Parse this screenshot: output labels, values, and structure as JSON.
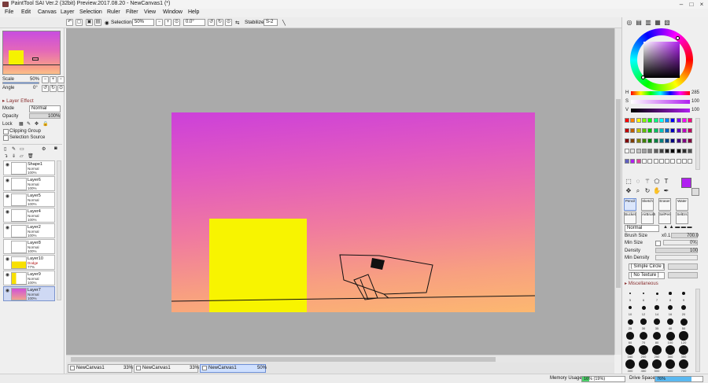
{
  "window": {
    "title": "PaintTool SAI Ver.2 (32bit) Preview.2017.08.20 - NewCanvas1 (*)"
  },
  "menu": [
    "File",
    "Edit",
    "Canvas",
    "Layer",
    "Selection",
    "Ruler",
    "Filter",
    "View",
    "Window",
    "Help"
  ],
  "toolbar": {
    "selection_label": "Selection",
    "zoom": "50%",
    "angle": "0.0°",
    "stabilizer_label": "Stabilizer",
    "stabilizer": "S-2"
  },
  "navigator": {
    "scale_label": "Scale",
    "scale": "50%",
    "angle_label": "Angle",
    "angle": "0°"
  },
  "layer_props": {
    "section": "Layer Effect",
    "mode_label": "Mode",
    "mode": "Normal",
    "opacity_label": "Opacity",
    "opacity": "100%",
    "lock_label": "Lock",
    "clipping": "Clipping Group",
    "selection_source": "Selection Source"
  },
  "layers": [
    {
      "name": "Shape1",
      "mode": "Normal",
      "opacity": "100%"
    },
    {
      "name": "Layer6",
      "mode": "Normal",
      "opacity": "100%"
    },
    {
      "name": "Layer5",
      "mode": "Normal",
      "opacity": "100%"
    },
    {
      "name": "Layer4",
      "mode": "Normal",
      "opacity": "100%"
    },
    {
      "name": "Layer2",
      "mode": "Normal",
      "opacity": "100%"
    },
    {
      "name": "Layer8",
      "mode": "Normal",
      "opacity": "100%"
    },
    {
      "name": "Layer10",
      "mode": "Dodge",
      "opacity": "77%"
    },
    {
      "name": "Layer9",
      "mode": "Normal",
      "opacity": "100%"
    },
    {
      "name": "Layer7",
      "mode": "Normal",
      "opacity": "100%"
    }
  ],
  "tabs": [
    {
      "name": "NewCanvas1",
      "zoom": "33%"
    },
    {
      "name": "NewCanvas1",
      "zoom": "33%"
    },
    {
      "name": "NewCanvas1",
      "zoom": "50%"
    }
  ],
  "status": {
    "memory_label": "Memory Usage",
    "memory": "16% (19%)",
    "drive_label": "Drive Space",
    "drive": "76%",
    "memory_fraction": 0.16,
    "drive_fraction": 0.76
  },
  "color": {
    "h_label": "H",
    "h": "285",
    "s_label": "S",
    "s": "100",
    "v_label": "V",
    "v": "100",
    "current": "#b020f0"
  },
  "tools": {
    "pencil": "Pencil",
    "sketch": "Sketch",
    "eraser": "Eraser",
    "water": "Water",
    "bucket": "Bucket",
    "airbrush": "AirBrush",
    "selpen": "SelPen",
    "selers": "SelErs"
  },
  "brush": {
    "mode": "Normal",
    "size_label": "Brush Size",
    "size_mult": "x0.1",
    "size": "700.0",
    "min_size_label": "Min Size",
    "min_size": "0%",
    "density_label": "Density",
    "density": "100",
    "min_density_label": "Min Density",
    "shape": "[ Simple Circle ]",
    "texture": "[ No Texture ]",
    "misc_label": "Miscellaneous"
  },
  "brush_sizes": [
    "5",
    "6",
    "7",
    "8",
    "9",
    "10",
    "12",
    "14",
    "16",
    "20",
    "25",
    "30",
    "35",
    "40",
    "50",
    "60",
    "70",
    "80",
    "100",
    "120",
    "160",
    "200",
    "250",
    "300",
    "350",
    "400",
    "450",
    "500",
    "600",
    "700"
  ]
}
